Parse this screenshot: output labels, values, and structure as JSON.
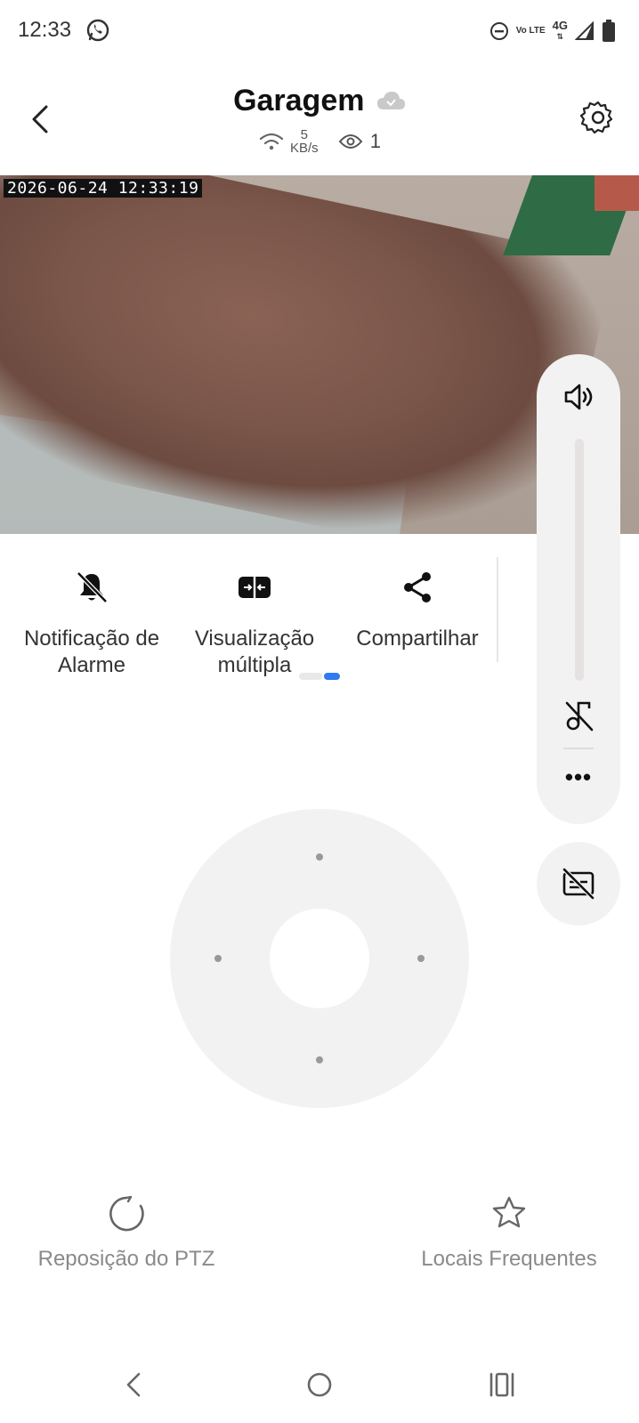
{
  "status_bar": {
    "time": "12:33",
    "icons": [
      "whatsapp-icon",
      "dnd-icon",
      "volte-icon",
      "4g-icon",
      "signal-icon",
      "battery-icon"
    ],
    "volte_label": "Vo LTE",
    "network_label": "4G"
  },
  "header": {
    "title": "Garagem",
    "cloud_icon": "cloud-check-icon",
    "speed_value": "5",
    "speed_unit": "KB/s",
    "viewers": "1"
  },
  "video": {
    "timestamp": "2026-06-24 12:33:19"
  },
  "actions": [
    {
      "label": "Notificação de Alarme",
      "icon": "bell-off-icon"
    },
    {
      "label": "Visualização múltipla",
      "icon": "split-view-icon"
    },
    {
      "label": "Compartilhar",
      "icon": "share-icon"
    }
  ],
  "side_panel": {
    "more_label": "•••"
  },
  "bottom": {
    "ptz_reset": "Reposição do PTZ",
    "frequent_locations": "Locais Frequentes"
  },
  "colors": {
    "accent": "#2f7af2",
    "panel_bg": "#f3f2f2"
  }
}
